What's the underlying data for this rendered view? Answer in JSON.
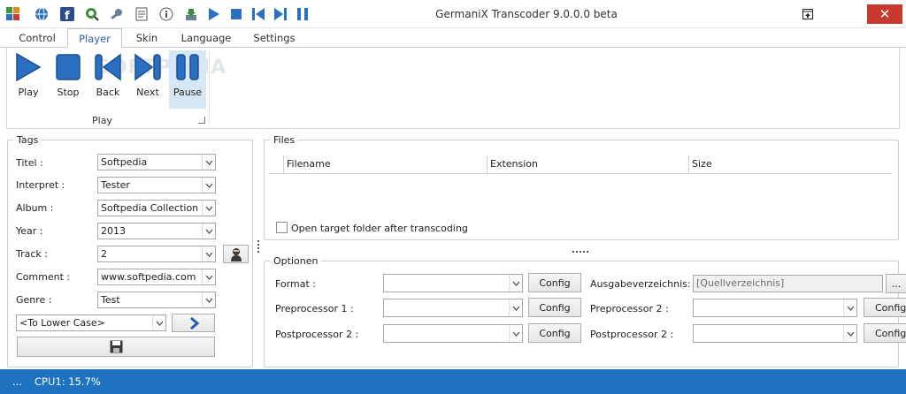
{
  "window": {
    "title": "GermaniX Transcoder 9.0.0.0 beta",
    "close_glyph": "✕"
  },
  "quick_access": [
    {
      "icon": "app-logo-icon"
    },
    {
      "icon": "globe-icon"
    },
    {
      "icon": "facebook-icon"
    },
    {
      "icon": "search-globe-icon"
    },
    {
      "icon": "settings-wrench-icon"
    },
    {
      "icon": "notepad-icon"
    },
    {
      "icon": "info-icon"
    },
    {
      "icon": "download-icon"
    },
    {
      "icon": "play-icon"
    },
    {
      "icon": "stop-icon"
    },
    {
      "icon": "back-icon"
    },
    {
      "icon": "next-icon"
    },
    {
      "icon": "pause-icon"
    }
  ],
  "tabs": [
    {
      "label": "Control",
      "active": false
    },
    {
      "label": "Player",
      "active": true
    },
    {
      "label": "Skin",
      "active": false
    },
    {
      "label": "Language",
      "active": false
    },
    {
      "label": "Settings",
      "active": false
    }
  ],
  "ribbon": {
    "buttons": [
      {
        "label": "Play",
        "icon": "play-icon"
      },
      {
        "label": "Stop",
        "icon": "stop-icon"
      },
      {
        "label": "Back",
        "icon": "back-icon"
      },
      {
        "label": "Next",
        "icon": "next-icon"
      },
      {
        "label": "Pause",
        "icon": "pause-icon",
        "selected": true
      }
    ],
    "group_label": "Play",
    "watermark": "SOFTPEDIA"
  },
  "tags": {
    "legend": "Tags",
    "fields": [
      {
        "label": "Titel :",
        "value": "Softpedia"
      },
      {
        "label": "Interpret :",
        "value": "Tester"
      },
      {
        "label": "Album :",
        "value": "Softpedia Collection"
      },
      {
        "label": "Year :",
        "value": "2013"
      },
      {
        "label": "Track :",
        "value": "2"
      },
      {
        "label": "Comment :",
        "value": "www.softpedia.com"
      },
      {
        "label": "Genre :",
        "value": "Test"
      }
    ],
    "case_select": "<To Lower Case>"
  },
  "files": {
    "legend": "Files",
    "columns": [
      "Filename",
      "Extension",
      "Size"
    ],
    "open_folder_label": "Open target folder after transcoding",
    "open_folder_checked": false
  },
  "options": {
    "legend": "Optionen",
    "format_label": "Format :",
    "pre1_label": "Preprocessor 1 :",
    "post2_label": "Postprocessor 2 :",
    "config_label": "Config",
    "output_dir_label": "Ausgabeverzeichnis:",
    "output_dir_value": "[Quellverzeichnis]",
    "browse_label": "...",
    "pre2_label": "Preprocessor 2 :",
    "post2b_label": "Postprocessor 2 :"
  },
  "status": {
    "dots": "...",
    "cpu": "CPU1: 15.7%"
  },
  "colors": {
    "accent": "#2b62a8",
    "icon_blue": "#2a6fc1",
    "status_bar": "#1e72c0",
    "close_red": "#c7392f"
  }
}
